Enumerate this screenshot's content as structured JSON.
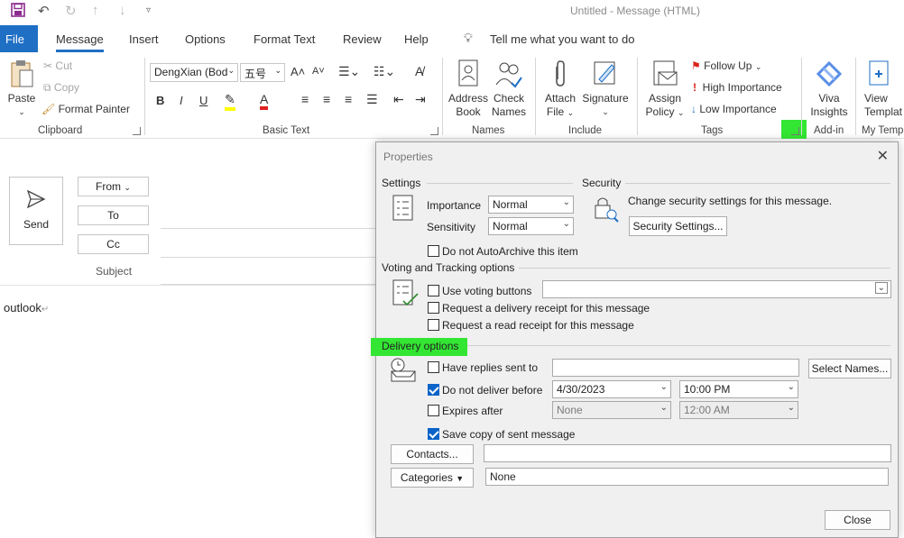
{
  "window": {
    "title": "Untitled  -  Message (HTML)"
  },
  "tabs": [
    "File",
    "Message",
    "Insert",
    "Options",
    "Format Text",
    "Review",
    "Help"
  ],
  "tell_me": "Tell me what you want to do",
  "ribbon": {
    "clipboard": {
      "label": "Clipboard",
      "paste": "Paste",
      "cut": "Cut",
      "copy": "Copy",
      "format_painter": "Format Painter"
    },
    "basic_text": {
      "label": "Basic Text",
      "font": "DengXian (Bod",
      "size": "五号"
    },
    "names": {
      "label": "Names",
      "address_book": [
        "Address",
        "Book"
      ],
      "check_names": [
        "Check",
        "Names"
      ]
    },
    "include": {
      "label": "Include",
      "attach_file": [
        "Attach",
        "File"
      ],
      "signature": "Signature"
    },
    "tags": {
      "label": "Tags",
      "assign_policy": [
        "Assign",
        "Policy"
      ],
      "follow_up": "Follow Up",
      "high_importance": "High Importance",
      "low_importance": "Low Importance"
    },
    "addin": {
      "label": "Add-in",
      "viva": [
        "Viva",
        "Insights"
      ]
    },
    "templates": {
      "label": "My Templ",
      "view": [
        "View",
        "Templat"
      ]
    }
  },
  "compose": {
    "send": "Send",
    "from": "From",
    "to": "To",
    "cc": "Cc",
    "subject": "Subject",
    "body": "outlook"
  },
  "dialog": {
    "title": "Properties",
    "settings": {
      "heading": "Settings",
      "importance_label": "Importance",
      "importance_value": "Normal",
      "sensitivity_label": "Sensitivity",
      "sensitivity_value": "Normal",
      "autoarchive": "Do not AutoArchive this item"
    },
    "security": {
      "heading": "Security",
      "text": "Change security settings for this message.",
      "button": "Security Settings..."
    },
    "voting": {
      "heading": "Voting and Tracking options",
      "use_voting": "Use voting buttons",
      "delivery_receipt": "Request a delivery receipt for this message",
      "read_receipt": "Request a read receipt for this message"
    },
    "delivery": {
      "heading": "Delivery options",
      "replies_to": "Have replies sent to",
      "select_names": "Select Names...",
      "do_not_deliver": "Do not deliver before",
      "deliver_date": "4/30/2023",
      "deliver_time": "10:00 PM",
      "expires_after": "Expires after",
      "expires_date": "None",
      "expires_time": "12:00 AM",
      "save_copy": "Save copy of sent message"
    },
    "contacts_button": "Contacts...",
    "categories_button": "Categories",
    "categories_value": "None",
    "close_button": "Close"
  },
  "colors": {
    "accent": "#1f6fc5",
    "highlight": "#33e633",
    "check": "#0a63c9"
  }
}
